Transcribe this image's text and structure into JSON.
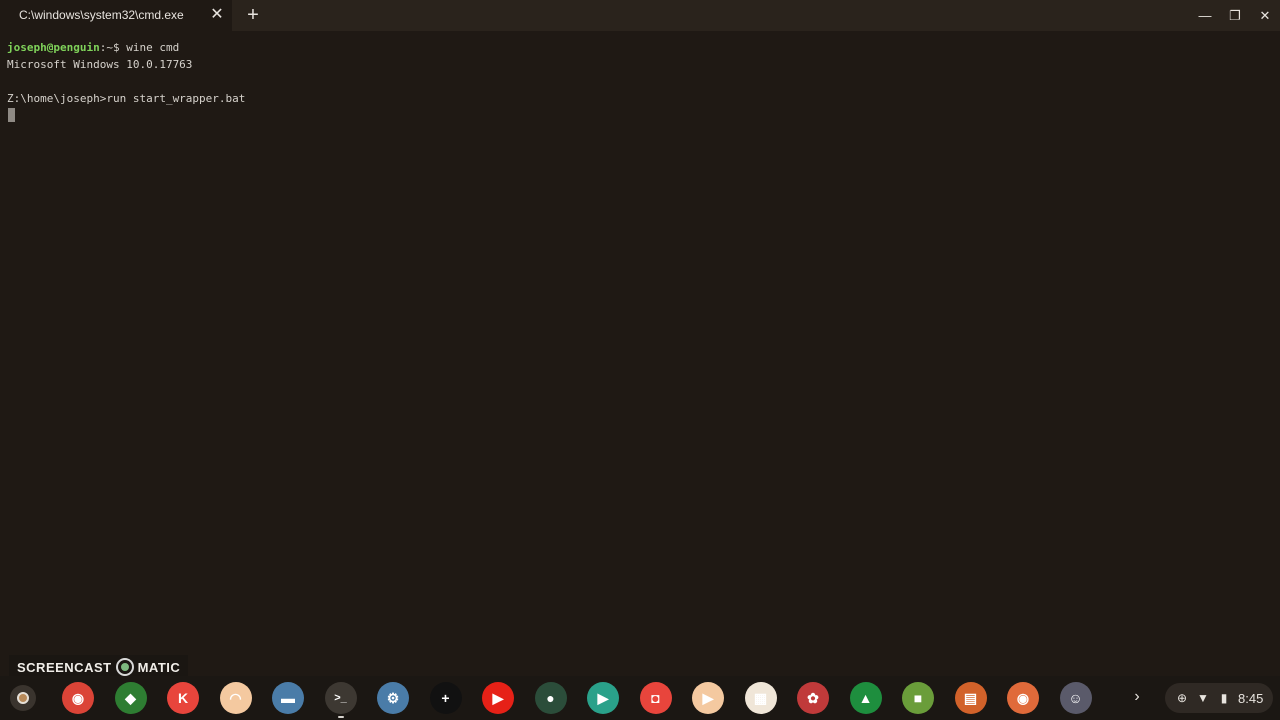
{
  "window": {
    "tab_title": "C:\\windows\\system32\\cmd.exe",
    "tab_close": "✕",
    "new_tab": "+",
    "minimize": "—",
    "maximize": "❐",
    "close": "✕"
  },
  "terminal": {
    "line1_user": "joseph@penguin",
    "line1_path": ":~$ ",
    "line1_cmd": "wine cmd",
    "line2": "Microsoft Windows 10.0.17763",
    "line4": "Z:\\home\\joseph>run start_wrapper.bat"
  },
  "watermark": {
    "left": "SCREENCAST",
    "right": "MATIC"
  },
  "shelf": {
    "chevron": "›",
    "time": "8:45",
    "apps": [
      {
        "name": "chrome-icon",
        "color": "#db4437"
      },
      {
        "name": "puffin-icon",
        "color": "#2e7d32"
      },
      {
        "name": "kiwi-icon",
        "color": "#e8453c"
      },
      {
        "name": "rainbow-app-icon",
        "color": "#f4c9a0"
      },
      {
        "name": "files-icon",
        "color": "#4a7ca8"
      },
      {
        "name": "terminal-icon",
        "color": "#3d3832"
      },
      {
        "name": "settings-icon",
        "color": "#4a7ca8"
      },
      {
        "name": "crosh-icon",
        "color": "#111111"
      },
      {
        "name": "youtube-icon",
        "color": "#e62117"
      },
      {
        "name": "screen-recorder-icon",
        "color": "#2b4d3a"
      },
      {
        "name": "youtube-music-icon",
        "color": "#2aa18a"
      },
      {
        "name": "screencast-icon",
        "color": "#e8453c"
      },
      {
        "name": "play-store-icon",
        "color": "#f4c9a0"
      },
      {
        "name": "qr-app-icon",
        "color": "#f0e6d8"
      },
      {
        "name": "game-app-icon",
        "color": "#c03a3a"
      },
      {
        "name": "drive-icon",
        "color": "#1e8e3e"
      },
      {
        "name": "minecraft-icon",
        "color": "#6a9d3a"
      },
      {
        "name": "winrar-icon",
        "color": "#d2622a"
      },
      {
        "name": "github-icon",
        "color": "#e06a3a"
      },
      {
        "name": "discord-icon",
        "color": "#5a5a6a"
      }
    ]
  }
}
